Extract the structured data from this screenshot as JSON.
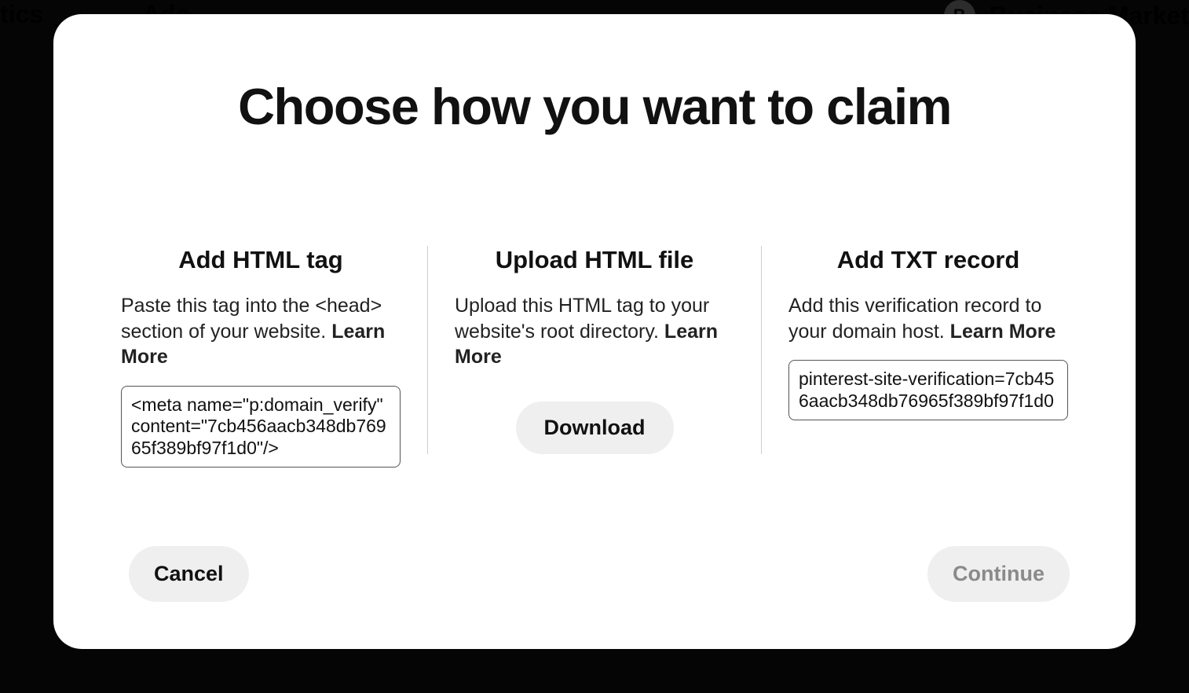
{
  "background_nav": {
    "left_items": [
      "tics",
      "Ads"
    ],
    "avatar_initial": "B",
    "right_label": "Business Market"
  },
  "modal": {
    "title": "Choose how you want to claim",
    "options": {
      "html_tag": {
        "title": "Add HTML tag",
        "description": "Paste this tag into the <head> section of your website. ",
        "learn_more": "Learn More",
        "code": "<meta name=\"p:domain_verify\" content=\"7cb456aacb348db76965f389bf97f1d0\"/>"
      },
      "html_file": {
        "title": "Upload HTML file",
        "description": "Upload this HTML tag to your website's root directory. ",
        "learn_more": "Learn More",
        "download_label": "Download"
      },
      "txt_record": {
        "title": "Add TXT record",
        "description": "Add this verification record to your domain host. ",
        "learn_more": "Learn More",
        "code": "pinterest-site-verification=7cb456aacb348db76965f389bf97f1d0"
      }
    },
    "footer": {
      "cancel": "Cancel",
      "continue": "Continue"
    }
  }
}
